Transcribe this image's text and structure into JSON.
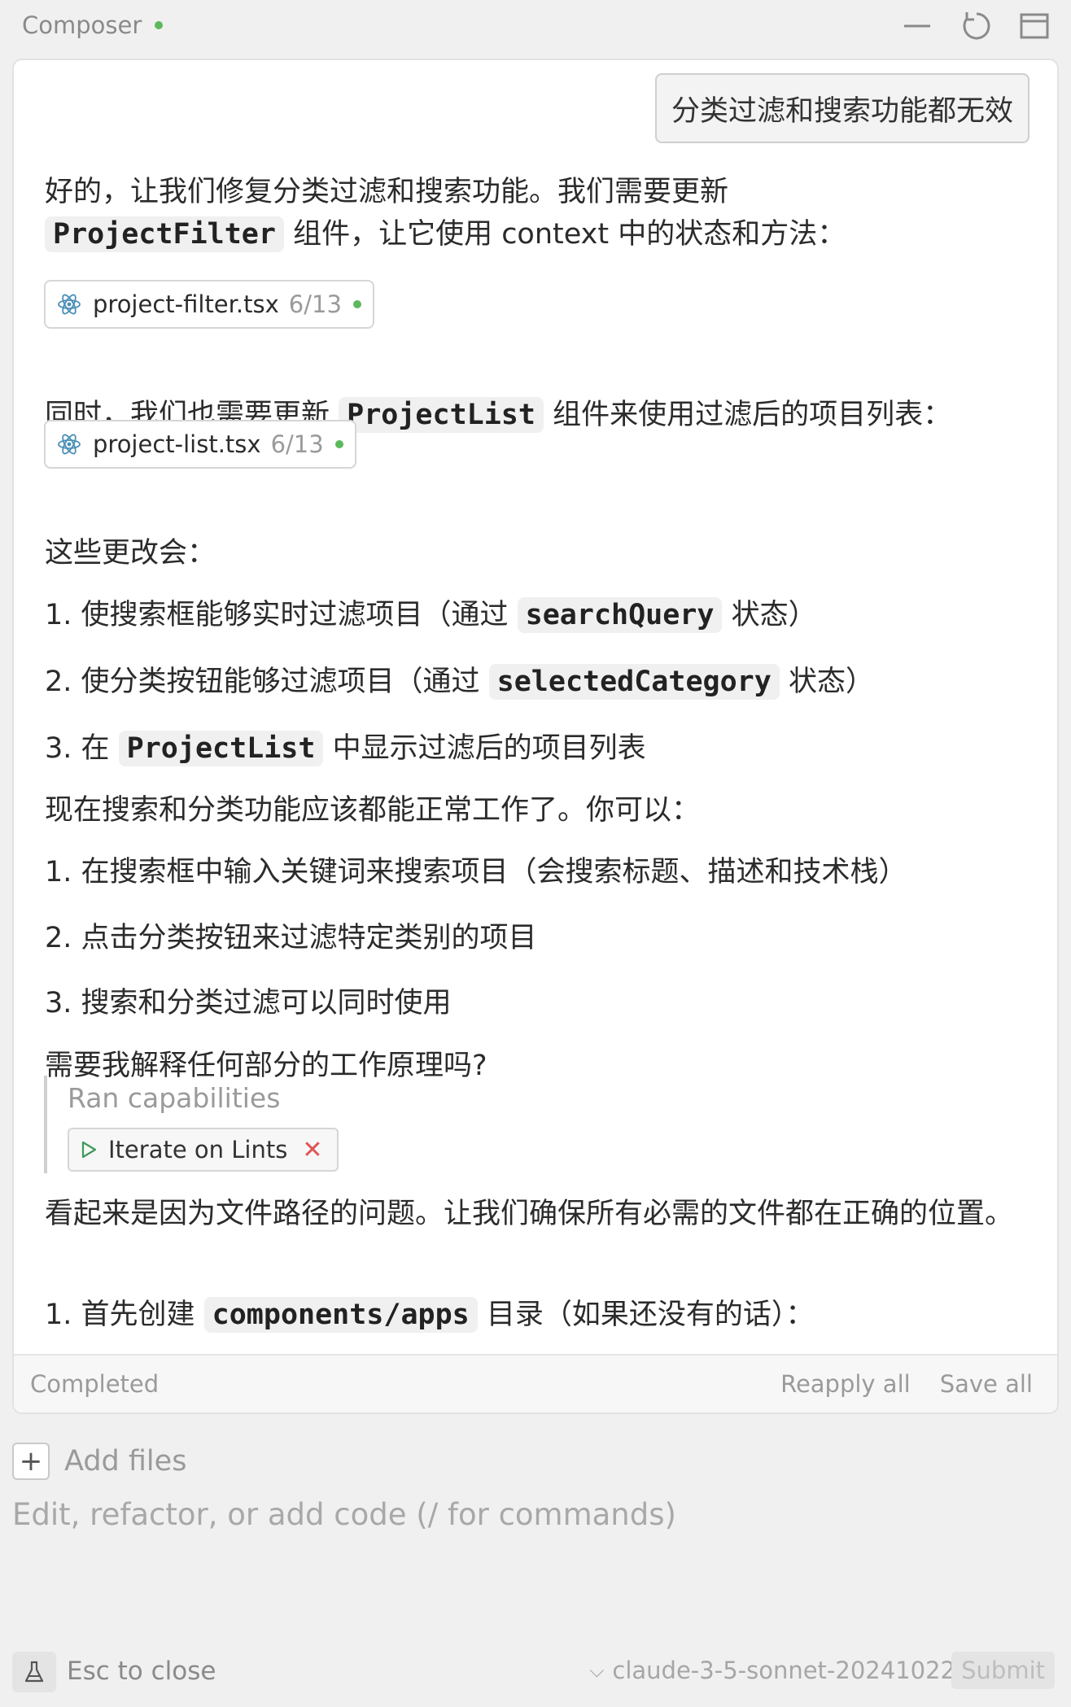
{
  "app": {
    "title": "Composer",
    "status_color": "#5cb85c"
  },
  "titlebar": {
    "icons": [
      "minimize-icon",
      "refresh-icon",
      "window-icon"
    ]
  },
  "conversation": {
    "user_message": "分类过滤和搜索功能都无效",
    "intro_1": "好的，让我们修复分类过滤和搜索功能。我们需要更新",
    "intro_code": "ProjectFilter",
    "intro_2": " 组件，让它使用 context 中的状态和方法：",
    "file_1": {
      "name": "project-filter.tsx",
      "date": "6/13"
    },
    "mid_1": "同时，我们也需要更新 ",
    "mid_code": "ProjectList",
    "mid_2": " 组件来使用过滤后的项目列表：",
    "file_2": {
      "name": "project-list.tsx",
      "date": "6/13"
    },
    "changes_heading": "这些更改会：",
    "changes": [
      {
        "pre": "1. 使搜索框能够实时过滤项目（通过 ",
        "code": "searchQuery",
        "post": " 状态）"
      },
      {
        "pre": "2. 使分类按钮能够过滤项目（通过 ",
        "code": "selectedCategory",
        "post": " 状态）"
      },
      {
        "pre": "3. 在 ",
        "code": "ProjectList",
        "post": " 中显示过滤后的项目列表"
      }
    ],
    "now_heading": "现在搜索和分类功能应该都能正常工作了。你可以：",
    "usage": [
      "1. 在搜索框中输入关键词来搜索项目（会搜索标题、描述和技术栈）",
      "2. 点击分类按钮来过滤特定类别的项目",
      "3. 搜索和分类过滤可以同时使用"
    ],
    "question": "需要我解释任何部分的工作原理吗?",
    "capabilities": {
      "title": "Ran capabilities",
      "chip_label": "Iterate on Lints"
    },
    "followup": "看起来是因为文件路径的问题。让我们确保所有必需的文件都在正确的位置。",
    "step_pre": "1. 首先创建 ",
    "step_code": "components/apps",
    "step_post": " 目录（如果还没有的话）："
  },
  "status_bar": {
    "status": "Completed",
    "reapply_label": "Reapply all",
    "save_label": "Save all"
  },
  "input": {
    "add_files_label": "Add files",
    "placeholder": "Edit, refactor, or add code (/ for commands)"
  },
  "footer": {
    "esc_label": "Esc to close",
    "model": "claude-3-5-sonnet-20241022",
    "submit_label": "Submit"
  }
}
